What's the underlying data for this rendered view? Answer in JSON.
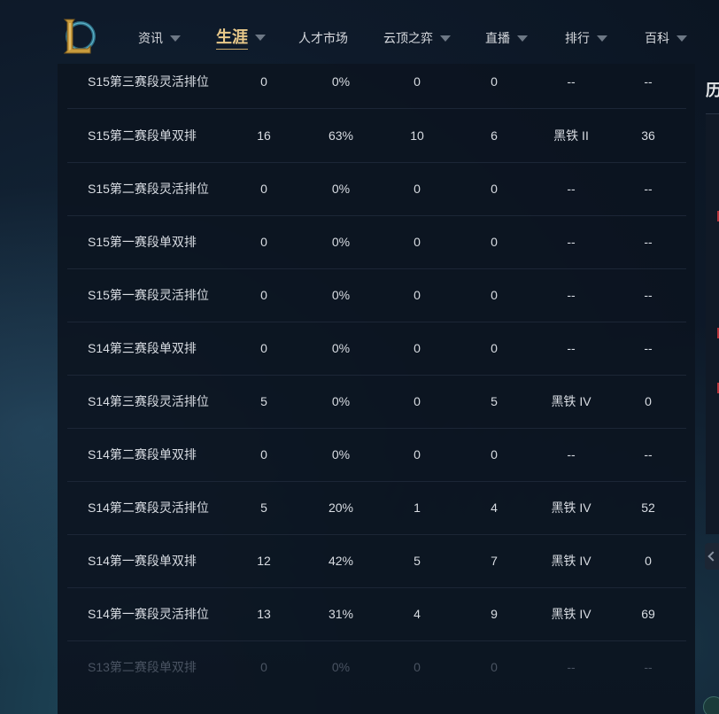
{
  "nav": {
    "items": [
      {
        "label": "资讯",
        "dropdown": true,
        "active": false
      },
      {
        "label": "生涯",
        "dropdown": true,
        "active": true
      },
      {
        "label": "人才市场",
        "dropdown": false,
        "active": false
      },
      {
        "label": "云顶之弈",
        "dropdown": true,
        "active": false
      },
      {
        "label": "直播",
        "dropdown": true,
        "active": false
      },
      {
        "label": "排行",
        "dropdown": true,
        "active": false
      },
      {
        "label": "百科",
        "dropdown": true,
        "active": false
      }
    ]
  },
  "logo": {
    "icon": "league-of-legends-logo-icon",
    "color": "#c89b3c"
  },
  "ranked_table": {
    "rows": [
      {
        "season": "S15第三赛段灵活排位",
        "games": "0",
        "winrate": "0%",
        "wins": "0",
        "losses": "0",
        "tier": "--",
        "points": "--"
      },
      {
        "season": "S15第二赛段单双排",
        "games": "16",
        "winrate": "63%",
        "wins": "10",
        "losses": "6",
        "tier": "黑铁 II",
        "points": "36"
      },
      {
        "season": "S15第二赛段灵活排位",
        "games": "0",
        "winrate": "0%",
        "wins": "0",
        "losses": "0",
        "tier": "--",
        "points": "--"
      },
      {
        "season": "S15第一赛段单双排",
        "games": "0",
        "winrate": "0%",
        "wins": "0",
        "losses": "0",
        "tier": "--",
        "points": "--"
      },
      {
        "season": "S15第一赛段灵活排位",
        "games": "0",
        "winrate": "0%",
        "wins": "0",
        "losses": "0",
        "tier": "--",
        "points": "--"
      },
      {
        "season": "S14第三赛段单双排",
        "games": "0",
        "winrate": "0%",
        "wins": "0",
        "losses": "0",
        "tier": "--",
        "points": "--"
      },
      {
        "season": "S14第三赛段灵活排位",
        "games": "5",
        "winrate": "0%",
        "wins": "0",
        "losses": "5",
        "tier": "黑铁 IV",
        "points": "0"
      },
      {
        "season": "S14第二赛段单双排",
        "games": "0",
        "winrate": "0%",
        "wins": "0",
        "losses": "0",
        "tier": "--",
        "points": "--"
      },
      {
        "season": "S14第二赛段灵活排位",
        "games": "5",
        "winrate": "20%",
        "wins": "1",
        "losses": "4",
        "tier": "黑铁 IV",
        "points": "52"
      },
      {
        "season": "S14第一赛段单双排",
        "games": "12",
        "winrate": "42%",
        "wins": "5",
        "losses": "7",
        "tier": "黑铁 IV",
        "points": "0"
      },
      {
        "season": "S14第一赛段灵活排位",
        "games": "13",
        "winrate": "31%",
        "wins": "4",
        "losses": "9",
        "tier": "黑铁 IV",
        "points": "69"
      },
      {
        "season": "S13第二赛段单双排",
        "games": "0",
        "winrate": "0%",
        "wins": "0",
        "losses": "0",
        "tier": "--",
        "points": "--"
      }
    ]
  },
  "side_panel": {
    "title": "历"
  },
  "colors": {
    "accent_gold": "#e8c98a",
    "text": "#d9dde3",
    "panel_bg": "#0c1420",
    "marker_red": "#b8333a"
  }
}
